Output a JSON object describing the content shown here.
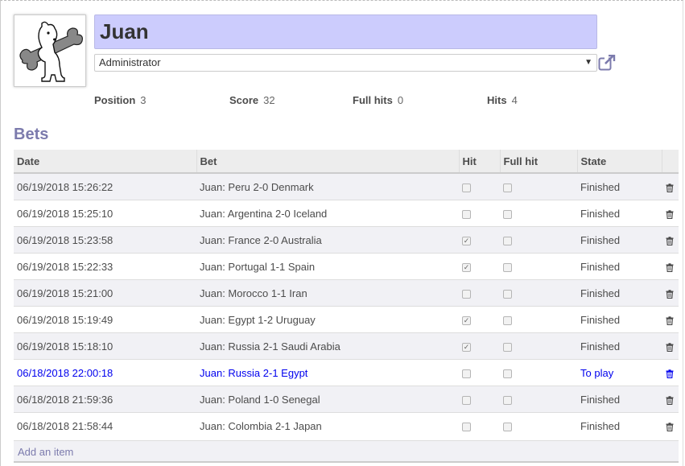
{
  "header": {
    "name": "Juan",
    "role": "Administrator"
  },
  "stats": [
    {
      "label": "Position",
      "value": "3"
    },
    {
      "label": "Score",
      "value": "32"
    },
    {
      "label": "Full hits",
      "value": "0"
    },
    {
      "label": "Hits",
      "value": "4"
    }
  ],
  "bets": {
    "title": "Bets",
    "columns": [
      "Date",
      "Bet",
      "Hit",
      "Full hit",
      "State"
    ],
    "rows": [
      {
        "date": "06/19/2018 15:26:22",
        "bet": "Juan: Peru 2-0 Denmark",
        "hit": false,
        "full_hit": false,
        "state": "Finished"
      },
      {
        "date": "06/19/2018 15:25:10",
        "bet": "Juan: Argentina 2-0 Iceland",
        "hit": false,
        "full_hit": false,
        "state": "Finished"
      },
      {
        "date": "06/19/2018 15:23:58",
        "bet": "Juan: France 2-0 Australia",
        "hit": true,
        "full_hit": false,
        "state": "Finished"
      },
      {
        "date": "06/19/2018 15:22:33",
        "bet": "Juan: Portugal 1-1 Spain",
        "hit": true,
        "full_hit": false,
        "state": "Finished"
      },
      {
        "date": "06/19/2018 15:21:00",
        "bet": "Juan: Morocco 1-1 Iran",
        "hit": false,
        "full_hit": false,
        "state": "Finished"
      },
      {
        "date": "06/19/2018 15:19:49",
        "bet": "Juan: Egypt 1-2 Uruguay",
        "hit": true,
        "full_hit": false,
        "state": "Finished"
      },
      {
        "date": "06/19/2018 15:18:10",
        "bet": "Juan: Russia 2-1 Saudi Arabia",
        "hit": true,
        "full_hit": false,
        "state": "Finished"
      },
      {
        "date": "06/18/2018 22:00:18",
        "bet": "Juan: Russia 2-1 Egypt",
        "hit": false,
        "full_hit": false,
        "state": "To play"
      },
      {
        "date": "06/18/2018 21:59:36",
        "bet": "Juan: Poland 1-0 Senegal",
        "hit": false,
        "full_hit": false,
        "state": "Finished"
      },
      {
        "date": "06/18/2018 21:58:44",
        "bet": "Juan: Colombia 2-1 Japan",
        "hit": false,
        "full_hit": false,
        "state": "Finished"
      }
    ],
    "add_label": "Add an item"
  },
  "colors": {
    "accent": "#7c7bad",
    "name_field_bg": "#ccccfd",
    "to_play": "#0000ee",
    "odd_row": "#f1f1f5"
  },
  "icons": {
    "external_link": "external-link-icon",
    "delete": "trash-icon",
    "avatar": "dog-with-bone-image"
  }
}
